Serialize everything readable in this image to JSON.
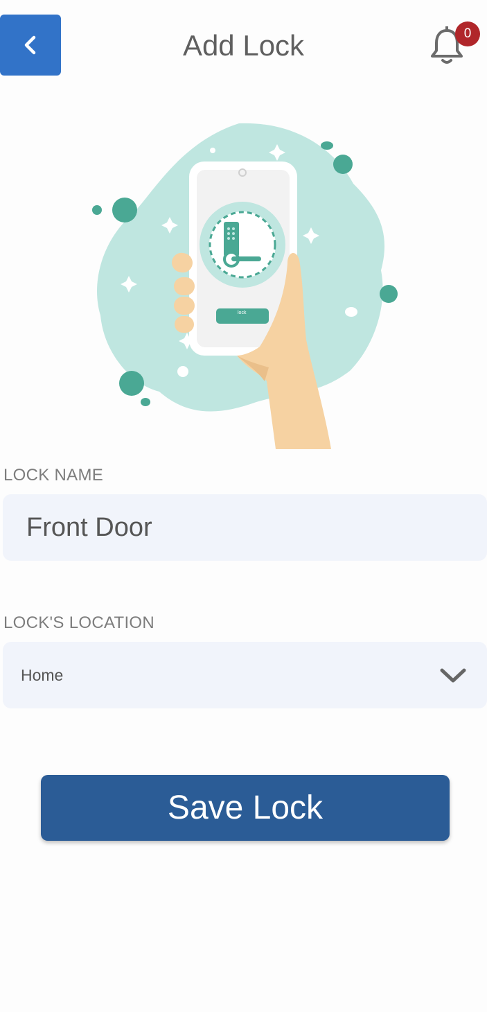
{
  "header": {
    "title": "Add Lock",
    "notification_count": "0"
  },
  "illustration": {
    "button_text": "lock",
    "colors": {
      "blob": "#bfe6e0",
      "accent": "#4aa894",
      "hand": "#f6d2a2",
      "phone": "#ffffff",
      "screen": "#f2f2f2"
    }
  },
  "form": {
    "lock_name_label": "LOCK NAME",
    "lock_name_value": "Front Door",
    "location_label": "LOCK'S LOCATION",
    "location_value": "Home"
  },
  "actions": {
    "save_label": "Save Lock"
  },
  "colors": {
    "primary": "#2b5c96",
    "back_button": "#3273c8",
    "badge": "#b0262a",
    "field_bg": "#f1f4fb"
  }
}
